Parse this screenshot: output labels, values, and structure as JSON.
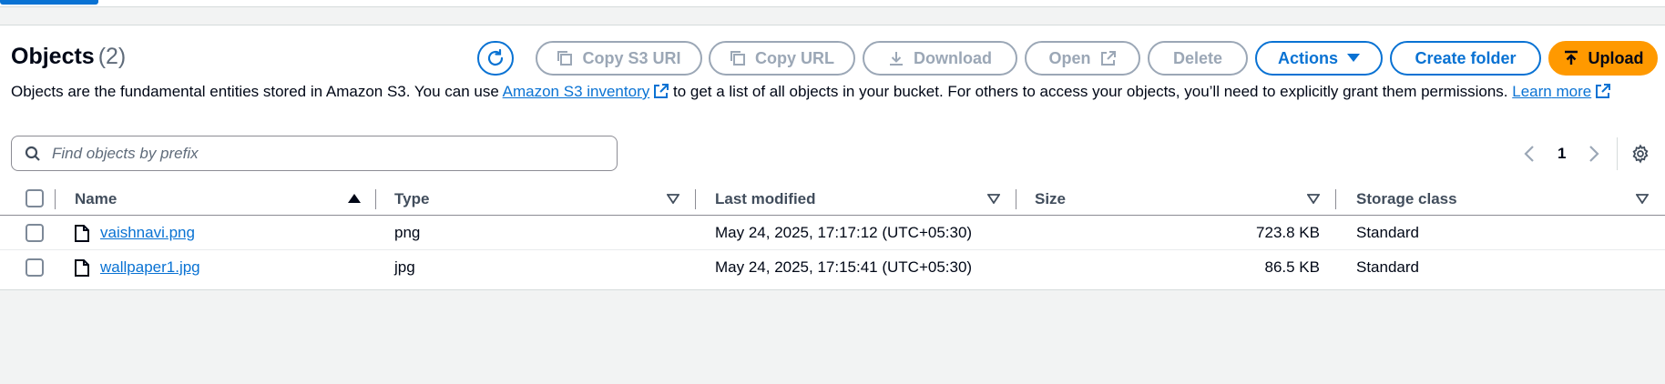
{
  "header": {
    "title": "Objects",
    "count": "(2)"
  },
  "toolbar": {
    "copy_s3_uri": "Copy S3 URI",
    "copy_url": "Copy URL",
    "download": "Download",
    "open": "Open",
    "delete": "Delete",
    "actions": "Actions",
    "create_folder": "Create folder",
    "upload": "Upload"
  },
  "description": {
    "part1": "Objects are the fundamental entities stored in Amazon S3. You can use",
    "link_inventory": "Amazon S3 inventory",
    "part2": "to get a list of all objects in your bucket. For others to access your objects, you’ll need to explicitly grant them permissions.",
    "link_learn": "Learn",
    "link_more": "more"
  },
  "search": {
    "placeholder": "Find objects by prefix",
    "value": ""
  },
  "pagination": {
    "current_page": "1"
  },
  "table": {
    "columns": [
      "Name",
      "Type",
      "Last modified",
      "Size",
      "Storage class"
    ],
    "rows": [
      {
        "name": "vaishnavi.png",
        "type": "png",
        "last_modified": "May 24, 2025, 17:17:12 (UTC+05:30)",
        "size": "723.8 KB",
        "storage_class": "Standard"
      },
      {
        "name": "wallpaper1.jpg",
        "type": "jpg",
        "last_modified": "May 24, 2025, 17:15:41 (UTC+05:30)",
        "size": "86.5 KB",
        "storage_class": "Standard"
      }
    ]
  },
  "icons": {
    "refresh": "refresh-icon",
    "copy": "copy-icon",
    "download": "download-icon",
    "external": "external-link-icon",
    "caret": "caret-down-icon",
    "upload": "upload-arrow-icon",
    "search": "search-icon",
    "file": "file-icon",
    "settings": "gear-icon"
  },
  "colors": {
    "accent": "#0972d3",
    "upload": "#ff9900",
    "disabled": "#9ba7b6"
  }
}
